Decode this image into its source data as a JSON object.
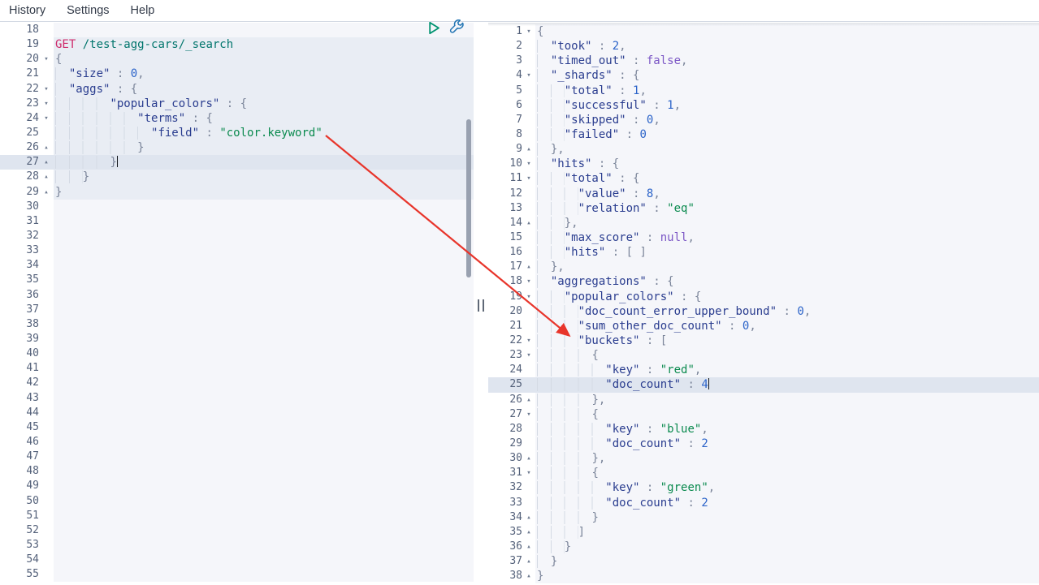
{
  "menu": {
    "items": [
      {
        "label": "History"
      },
      {
        "label": "Settings"
      },
      {
        "label": "Help"
      }
    ]
  },
  "icons": {
    "play": "triangle-outline (send request)",
    "wrench": "wrench-outline (request options)",
    "fold_open": "▾",
    "fold_close": "▴",
    "resize_handle": "∥"
  },
  "colors": {
    "key": "#2a3d8f",
    "string": "#0a8a4e",
    "number": "#2c64c9",
    "keyword": "#7b56c5",
    "punct": "#7a8499",
    "method": "#ce2a6a",
    "url": "#00756c",
    "line_number": "#54617a",
    "editor_bg": "#f5f6fa",
    "request_bg": "#e9edf4",
    "active_line_bg": "#dfe5ef",
    "gutter_bg": "#ffffff",
    "guide": "#d4dae4",
    "arrow": "#e8352b",
    "play_icon": "#019371",
    "wrench_icon": "#2476b4",
    "menu_text": "#333b49",
    "scrollbar": "#99a1b0"
  },
  "request_editor": {
    "lines": [
      {
        "n": 18,
        "t": []
      },
      {
        "n": 19,
        "req": true,
        "t": [
          [
            "m",
            "GET"
          ],
          [
            "p",
            " "
          ],
          [
            "u",
            "/test-agg-cars/_search"
          ]
        ]
      },
      {
        "n": 20,
        "req": true,
        "fold": "open",
        "t": [
          [
            "p",
            "{"
          ]
        ]
      },
      {
        "n": 21,
        "req": true,
        "t": [
          [
            "w",
            "  "
          ],
          [
            "k",
            "\"size\""
          ],
          [
            "p",
            " : "
          ],
          [
            "n",
            "0"
          ],
          [
            "p",
            ","
          ]
        ]
      },
      {
        "n": 22,
        "req": true,
        "fold": "open",
        "t": [
          [
            "w",
            "  "
          ],
          [
            "k",
            "\"aggs\""
          ],
          [
            "p",
            " : "
          ],
          [
            "p",
            "{"
          ]
        ]
      },
      {
        "n": 23,
        "req": true,
        "fold": "open",
        "t": [
          [
            "w",
            "        "
          ],
          [
            "k",
            "\"popular_colors\""
          ],
          [
            "p",
            " : "
          ],
          [
            "p",
            "{"
          ]
        ]
      },
      {
        "n": 24,
        "req": true,
        "fold": "open",
        "t": [
          [
            "w",
            "            "
          ],
          [
            "k",
            "\"terms\""
          ],
          [
            "p",
            " : "
          ],
          [
            "p",
            "{"
          ]
        ]
      },
      {
        "n": 25,
        "req": true,
        "t": [
          [
            "w",
            "              "
          ],
          [
            "k",
            "\"field\""
          ],
          [
            "p",
            " : "
          ],
          [
            "s",
            "\"color.keyword\""
          ]
        ]
      },
      {
        "n": 26,
        "req": true,
        "fold": "close",
        "t": [
          [
            "w",
            "            "
          ],
          [
            "p",
            "}"
          ]
        ]
      },
      {
        "n": 27,
        "req": true,
        "fold": "close",
        "active": true,
        "t": [
          [
            "w",
            "        "
          ],
          [
            "p",
            "}"
          ],
          [
            "c",
            ""
          ]
        ]
      },
      {
        "n": 28,
        "req": true,
        "fold": "close",
        "t": [
          [
            "w",
            "    "
          ],
          [
            "p",
            "}"
          ]
        ]
      },
      {
        "n": 29,
        "req": true,
        "fold": "close",
        "t": [
          [
            "p",
            "}"
          ]
        ]
      },
      {
        "n": 30,
        "t": []
      },
      {
        "n": 31,
        "t": []
      },
      {
        "n": 32,
        "t": []
      },
      {
        "n": 33,
        "t": []
      },
      {
        "n": 34,
        "t": []
      },
      {
        "n": 35,
        "t": []
      },
      {
        "n": 36,
        "t": []
      },
      {
        "n": 37,
        "t": []
      },
      {
        "n": 38,
        "t": []
      },
      {
        "n": 39,
        "t": []
      },
      {
        "n": 40,
        "t": []
      },
      {
        "n": 41,
        "t": []
      },
      {
        "n": 42,
        "t": []
      },
      {
        "n": 43,
        "t": []
      },
      {
        "n": 44,
        "t": []
      },
      {
        "n": 45,
        "t": []
      },
      {
        "n": 46,
        "t": []
      },
      {
        "n": 47,
        "t": []
      },
      {
        "n": 48,
        "t": []
      },
      {
        "n": 49,
        "t": []
      },
      {
        "n": 50,
        "t": []
      },
      {
        "n": 51,
        "t": []
      },
      {
        "n": 52,
        "t": []
      },
      {
        "n": 53,
        "t": []
      },
      {
        "n": 54,
        "t": []
      },
      {
        "n": 55,
        "t": []
      }
    ]
  },
  "response_editor": {
    "lines": [
      {
        "n": 1,
        "fold": "open",
        "t": [
          [
            "p",
            "{"
          ]
        ]
      },
      {
        "n": 2,
        "t": [
          [
            "w",
            "  "
          ],
          [
            "k",
            "\"took\""
          ],
          [
            "p",
            " : "
          ],
          [
            "n",
            "2"
          ],
          [
            "p",
            ","
          ]
        ]
      },
      {
        "n": 3,
        "t": [
          [
            "w",
            "  "
          ],
          [
            "k",
            "\"timed_out\""
          ],
          [
            "p",
            " : "
          ],
          [
            "b",
            "false"
          ],
          [
            "p",
            ","
          ]
        ]
      },
      {
        "n": 4,
        "fold": "open",
        "t": [
          [
            "w",
            "  "
          ],
          [
            "k",
            "\"_shards\""
          ],
          [
            "p",
            " : "
          ],
          [
            "p",
            "{"
          ]
        ]
      },
      {
        "n": 5,
        "t": [
          [
            "w",
            "    "
          ],
          [
            "k",
            "\"total\""
          ],
          [
            "p",
            " : "
          ],
          [
            "n",
            "1"
          ],
          [
            "p",
            ","
          ]
        ]
      },
      {
        "n": 6,
        "t": [
          [
            "w",
            "    "
          ],
          [
            "k",
            "\"successful\""
          ],
          [
            "p",
            " : "
          ],
          [
            "n",
            "1"
          ],
          [
            "p",
            ","
          ]
        ]
      },
      {
        "n": 7,
        "t": [
          [
            "w",
            "    "
          ],
          [
            "k",
            "\"skipped\""
          ],
          [
            "p",
            " : "
          ],
          [
            "n",
            "0"
          ],
          [
            "p",
            ","
          ]
        ]
      },
      {
        "n": 8,
        "t": [
          [
            "w",
            "    "
          ],
          [
            "k",
            "\"failed\""
          ],
          [
            "p",
            " : "
          ],
          [
            "n",
            "0"
          ]
        ]
      },
      {
        "n": 9,
        "fold": "close",
        "t": [
          [
            "w",
            "  "
          ],
          [
            "p",
            "},"
          ]
        ]
      },
      {
        "n": 10,
        "fold": "open",
        "t": [
          [
            "w",
            "  "
          ],
          [
            "k",
            "\"hits\""
          ],
          [
            "p",
            " : "
          ],
          [
            "p",
            "{"
          ]
        ]
      },
      {
        "n": 11,
        "fold": "open",
        "t": [
          [
            "w",
            "    "
          ],
          [
            "k",
            "\"total\""
          ],
          [
            "p",
            " : "
          ],
          [
            "p",
            "{"
          ]
        ]
      },
      {
        "n": 12,
        "t": [
          [
            "w",
            "      "
          ],
          [
            "k",
            "\"value\""
          ],
          [
            "p",
            " : "
          ],
          [
            "n",
            "8"
          ],
          [
            "p",
            ","
          ]
        ]
      },
      {
        "n": 13,
        "t": [
          [
            "w",
            "      "
          ],
          [
            "k",
            "\"relation\""
          ],
          [
            "p",
            " : "
          ],
          [
            "s",
            "\"eq\""
          ]
        ]
      },
      {
        "n": 14,
        "fold": "close",
        "t": [
          [
            "w",
            "    "
          ],
          [
            "p",
            "},"
          ]
        ]
      },
      {
        "n": 15,
        "t": [
          [
            "w",
            "    "
          ],
          [
            "k",
            "\"max_score\""
          ],
          [
            "p",
            " : "
          ],
          [
            "b",
            "null"
          ],
          [
            "p",
            ","
          ]
        ]
      },
      {
        "n": 16,
        "t": [
          [
            "w",
            "    "
          ],
          [
            "k",
            "\"hits\""
          ],
          [
            "p",
            " : "
          ],
          [
            "p",
            "[ ]"
          ]
        ]
      },
      {
        "n": 17,
        "fold": "close",
        "t": [
          [
            "w",
            "  "
          ],
          [
            "p",
            "},"
          ]
        ]
      },
      {
        "n": 18,
        "fold": "open",
        "t": [
          [
            "w",
            "  "
          ],
          [
            "k",
            "\"aggregations\""
          ],
          [
            "p",
            " : "
          ],
          [
            "p",
            "{"
          ]
        ]
      },
      {
        "n": 19,
        "fold": "open",
        "t": [
          [
            "w",
            "    "
          ],
          [
            "k",
            "\"popular_colors\""
          ],
          [
            "p",
            " : "
          ],
          [
            "p",
            "{"
          ]
        ]
      },
      {
        "n": 20,
        "t": [
          [
            "w",
            "      "
          ],
          [
            "k",
            "\"doc_count_error_upper_bound\""
          ],
          [
            "p",
            " : "
          ],
          [
            "n",
            "0"
          ],
          [
            "p",
            ","
          ]
        ]
      },
      {
        "n": 21,
        "t": [
          [
            "w",
            "      "
          ],
          [
            "k",
            "\"sum_other_doc_count\""
          ],
          [
            "p",
            " : "
          ],
          [
            "n",
            "0"
          ],
          [
            "p",
            ","
          ]
        ]
      },
      {
        "n": 22,
        "fold": "open",
        "t": [
          [
            "w",
            "      "
          ],
          [
            "k",
            "\"buckets\""
          ],
          [
            "p",
            " : "
          ],
          [
            "p",
            "["
          ]
        ]
      },
      {
        "n": 23,
        "fold": "open",
        "t": [
          [
            "w",
            "        "
          ],
          [
            "p",
            "{"
          ]
        ]
      },
      {
        "n": 24,
        "t": [
          [
            "w",
            "          "
          ],
          [
            "k",
            "\"key\""
          ],
          [
            "p",
            " : "
          ],
          [
            "s",
            "\"red\""
          ],
          [
            "p",
            ","
          ]
        ]
      },
      {
        "n": 25,
        "active": true,
        "t": [
          [
            "w",
            "          "
          ],
          [
            "k",
            "\"doc_count\""
          ],
          [
            "p",
            " : "
          ],
          [
            "n",
            "4"
          ],
          [
            "c",
            ""
          ]
        ]
      },
      {
        "n": 26,
        "fold": "close",
        "t": [
          [
            "w",
            "        "
          ],
          [
            "p",
            "},"
          ]
        ]
      },
      {
        "n": 27,
        "fold": "open",
        "t": [
          [
            "w",
            "        "
          ],
          [
            "p",
            "{"
          ]
        ]
      },
      {
        "n": 28,
        "t": [
          [
            "w",
            "          "
          ],
          [
            "k",
            "\"key\""
          ],
          [
            "p",
            " : "
          ],
          [
            "s",
            "\"blue\""
          ],
          [
            "p",
            ","
          ]
        ]
      },
      {
        "n": 29,
        "t": [
          [
            "w",
            "          "
          ],
          [
            "k",
            "\"doc_count\""
          ],
          [
            "p",
            " : "
          ],
          [
            "n",
            "2"
          ]
        ]
      },
      {
        "n": 30,
        "fold": "close",
        "t": [
          [
            "w",
            "        "
          ],
          [
            "p",
            "},"
          ]
        ]
      },
      {
        "n": 31,
        "fold": "open",
        "t": [
          [
            "w",
            "        "
          ],
          [
            "p",
            "{"
          ]
        ]
      },
      {
        "n": 32,
        "t": [
          [
            "w",
            "          "
          ],
          [
            "k",
            "\"key\""
          ],
          [
            "p",
            " : "
          ],
          [
            "s",
            "\"green\""
          ],
          [
            "p",
            ","
          ]
        ]
      },
      {
        "n": 33,
        "t": [
          [
            "w",
            "          "
          ],
          [
            "k",
            "\"doc_count\""
          ],
          [
            "p",
            " : "
          ],
          [
            "n",
            "2"
          ]
        ]
      },
      {
        "n": 34,
        "fold": "close",
        "t": [
          [
            "w",
            "        "
          ],
          [
            "p",
            "}"
          ]
        ]
      },
      {
        "n": 35,
        "fold": "close",
        "t": [
          [
            "w",
            "      "
          ],
          [
            "p",
            "]"
          ]
        ]
      },
      {
        "n": 36,
        "fold": "close",
        "t": [
          [
            "w",
            "    "
          ],
          [
            "p",
            "}"
          ]
        ]
      },
      {
        "n": 37,
        "fold": "close",
        "t": [
          [
            "w",
            "  "
          ],
          [
            "p",
            "}"
          ]
        ]
      },
      {
        "n": 38,
        "fold": "close",
        "t": [
          [
            "p",
            "}"
          ]
        ]
      }
    ]
  },
  "annotation": {
    "arrow_from_text": "color.keyword",
    "arrow_to_text": "buckets"
  }
}
